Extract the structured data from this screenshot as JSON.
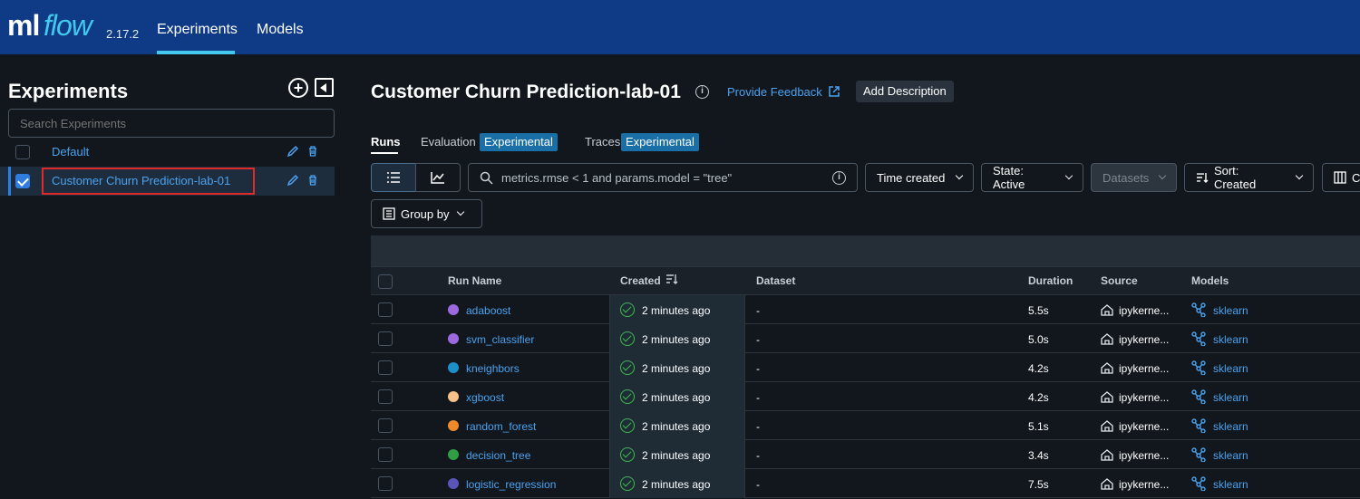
{
  "header": {
    "logo_ml": "ml",
    "logo_flow": "flow",
    "version": "2.17.2",
    "nav": [
      {
        "label": "Experiments"
      },
      {
        "label": "Models"
      }
    ]
  },
  "sidebar": {
    "title": "Experiments",
    "search_placeholder": "Search Experiments",
    "experiments": [
      {
        "name": "Default",
        "checked": false
      },
      {
        "name": "Customer Churn Prediction-lab-01",
        "checked": true
      }
    ]
  },
  "main": {
    "title": "Customer Churn Prediction-lab-01",
    "feedback_link": "Provide Feedback",
    "add_description": "Add Description",
    "tabs": [
      {
        "label": "Runs"
      },
      {
        "label": "Evaluation",
        "badge": "Experimental"
      },
      {
        "label": "Traces",
        "badge": "Experimental"
      }
    ],
    "toolbar": {
      "search_query": "metrics.rmse < 1 and params.model = \"tree\"",
      "time_created": "Time created",
      "state": "State: Active",
      "datasets": "Datasets",
      "sort": "Sort: Created",
      "columns": "C",
      "group_by": "Group by"
    },
    "columns": [
      "Run Name",
      "Created",
      "Dataset",
      "Duration",
      "Source",
      "Models"
    ],
    "runs": [
      {
        "name": "adaboost",
        "color": "#9c6ade",
        "created": "2 minutes ago",
        "dataset": "-",
        "duration": "5.5s",
        "source": "ipykerne...",
        "model": "sklearn"
      },
      {
        "name": "svm_classifier",
        "color": "#9c6ade",
        "created": "2 minutes ago",
        "dataset": "-",
        "duration": "5.0s",
        "source": "ipykerne...",
        "model": "sklearn"
      },
      {
        "name": "kneighbors",
        "color": "#1d8fc8",
        "created": "2 minutes ago",
        "dataset": "-",
        "duration": "4.2s",
        "source": "ipykerne...",
        "model": "sklearn"
      },
      {
        "name": "xgboost",
        "color": "#f5c08a",
        "created": "2 minutes ago",
        "dataset": "-",
        "duration": "4.2s",
        "source": "ipykerne...",
        "model": "sklearn"
      },
      {
        "name": "random_forest",
        "color": "#ef8a2c",
        "created": "2 minutes ago",
        "dataset": "-",
        "duration": "5.1s",
        "source": "ipykerne...",
        "model": "sklearn"
      },
      {
        "name": "decision_tree",
        "color": "#2f9e44",
        "created": "2 minutes ago",
        "dataset": "-",
        "duration": "3.4s",
        "source": "ipykerne...",
        "model": "sklearn"
      },
      {
        "name": "logistic_regression",
        "color": "#5a55b8",
        "created": "2 minutes ago",
        "dataset": "-",
        "duration": "7.5s",
        "source": "ipykerne...",
        "model": "sklearn"
      }
    ]
  }
}
